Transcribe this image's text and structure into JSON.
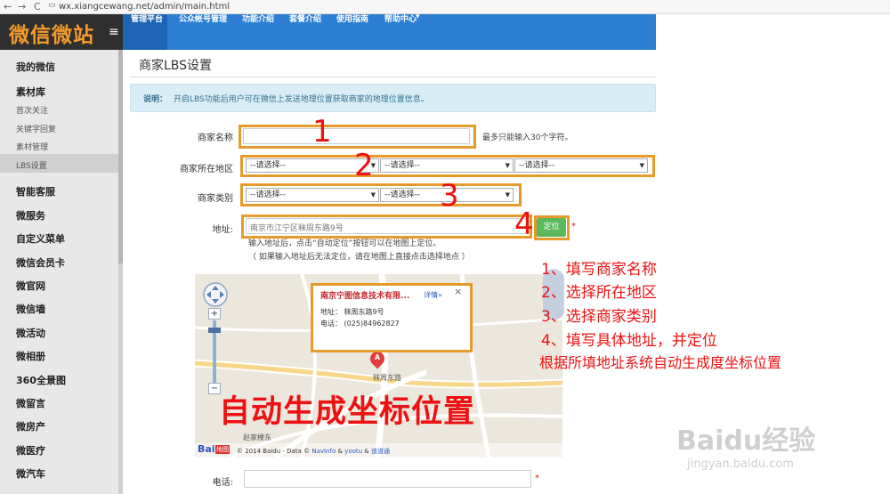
{
  "browser": {
    "url": "wx.xiangcewang.net/admin/main.html",
    "back": "←",
    "forward": "→",
    "reload": "C"
  },
  "logo": {
    "text": "微信微站",
    "menu_icon": "≡"
  },
  "sidebar": {
    "items": [
      {
        "label": "我的微信"
      },
      {
        "label": "素材库"
      },
      {
        "label": "首次关注"
      },
      {
        "label": "关键字回复"
      },
      {
        "label": "素材管理"
      },
      {
        "label": "LBS设置"
      },
      {
        "label": "智能客服"
      },
      {
        "label": "微服务"
      },
      {
        "label": "自定义菜单"
      },
      {
        "label": "微信会员卡"
      },
      {
        "label": "微官网"
      },
      {
        "label": "微信墙"
      },
      {
        "label": "微活动"
      },
      {
        "label": "微相册"
      },
      {
        "label": "360全景图"
      },
      {
        "label": "微留言"
      },
      {
        "label": "微房产"
      },
      {
        "label": "微医疗"
      },
      {
        "label": "微汽车"
      }
    ]
  },
  "topnav": {
    "items": [
      "管理平台",
      "公众帐号管理",
      "功能介绍",
      "套餐介绍",
      "使用指南",
      "帮助中心"
    ],
    "dropdown_caret": "▾"
  },
  "page": {
    "title": "商家LBS设置"
  },
  "info": {
    "label": "说明：",
    "text": "开启LBS功能后用户可在微信上发送地理位置获取商家的地理位置信息。"
  },
  "form": {
    "name_label": "商家名称",
    "name_hint": "最多只能输入30个字符。",
    "region_label": "商家所在地区",
    "region_selects": [
      "--请选择--",
      "--请选择--",
      "--请选择--"
    ],
    "category_label": "商家类别",
    "category_selects": [
      "--请选择--",
      "--请选择--"
    ],
    "address_label": "地址:",
    "address_value": "南京市江宁区秣周东路9号",
    "locate_button": "定位",
    "required": "*",
    "address_hint1": "输入地址后，点击“自动定位”按钮可以在地图上定位。",
    "address_hint2": "（ 如果输入地址后无法定位，请在地图上直接点击选择地点 ）",
    "phone_label": "电话:"
  },
  "steps": [
    "1",
    "2",
    "3",
    "4"
  ],
  "map": {
    "popup_title": "南京宁图信息技术有限...",
    "popup_detail": "详情»",
    "popup_close": "×",
    "popup_addr": "地址：  秣周东路9号",
    "popup_phone": "电话：  (025)84962827",
    "marker": "A",
    "road": "秣周东路",
    "place": "赵家楼东",
    "logo_text": "Bai",
    "logo_text2": "地图",
    "copyright": "© 2014 Baidu - Data © ",
    "navinfo": "NavInfo",
    "amp1": " & ",
    "yootu": "yootu",
    "amp2": " & ",
    "daodao": "道道通",
    "zoom_plus": "+",
    "zoom_minus": "−"
  },
  "annotations": {
    "lines": [
      "1、填写商家名称",
      "2、选择所在地区",
      "3、选择商家类别",
      "4、填写具体地址，并定位",
      "根据所填地址系统自动生成度坐标位置"
    ],
    "big": "自动生成坐标位置"
  },
  "watermark": {
    "main": "Baidu经验",
    "sub": "jingyan.baidu.com"
  }
}
